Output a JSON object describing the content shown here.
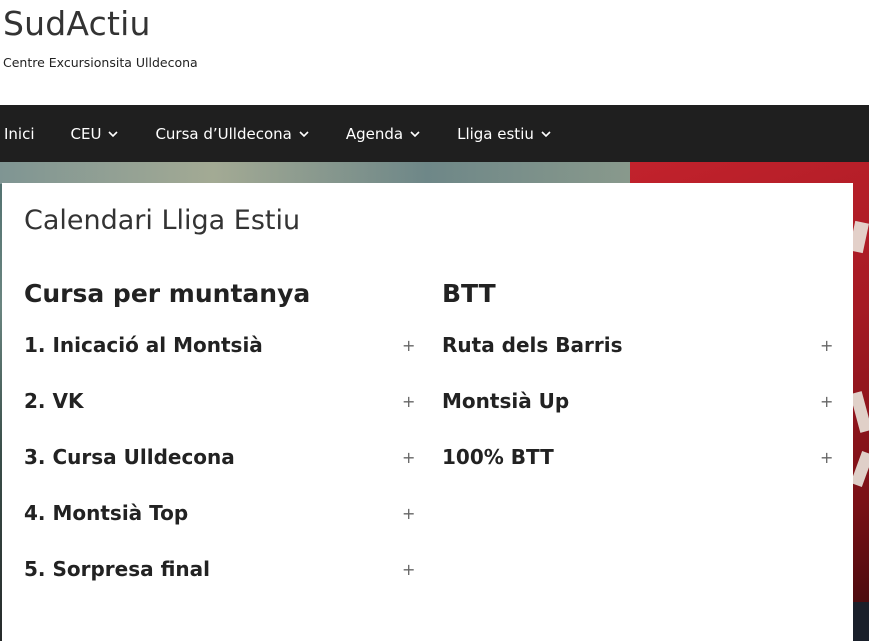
{
  "site": {
    "title": "SudActiu",
    "tagline": "Centre Excursionsita Ulldecona"
  },
  "nav": {
    "items": [
      {
        "label": "Inici",
        "has_dropdown": false
      },
      {
        "label": "CEU",
        "has_dropdown": true
      },
      {
        "label": "Cursa d’Ulldecona",
        "has_dropdown": true
      },
      {
        "label": "Agenda",
        "has_dropdown": true
      },
      {
        "label": "Lliga estiu",
        "has_dropdown": true
      }
    ]
  },
  "page": {
    "title": "Calendari Lliga Estiu",
    "columns": [
      {
        "heading": "Cursa per muntanya",
        "items": [
          {
            "label": "1. Inicació al Montsià",
            "toggle": "+"
          },
          {
            "label": "2. VK",
            "toggle": "+"
          },
          {
            "label": "3. Cursa Ulldecona",
            "toggle": "+"
          },
          {
            "label": "4. Montsià Top",
            "toggle": "+"
          },
          {
            "label": "5. Sorpresa final",
            "toggle": "+"
          }
        ]
      },
      {
        "heading": "BTT",
        "items": [
          {
            "label": "Ruta dels Barris",
            "toggle": "+"
          },
          {
            "label": "Montsià Up",
            "toggle": "+"
          },
          {
            "label": "100% BTT",
            "toggle": "+"
          }
        ]
      }
    ]
  },
  "colors": {
    "nav_background": "#1f1f1f",
    "nav_text": "#ffffff",
    "text_dark": "#222222",
    "toggle_grey": "#666666"
  }
}
